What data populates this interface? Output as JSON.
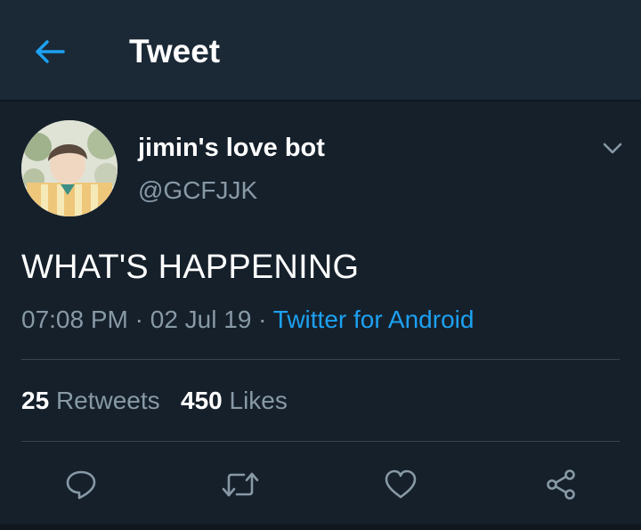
{
  "header": {
    "title": "Tweet",
    "back_icon": "arrow-left-icon"
  },
  "tweet": {
    "display_name": "jimin's love bot",
    "handle": "@GCFJJK",
    "text": "WHAT'S HAPPENING",
    "time": "07:08 PM",
    "separator_1": " · ",
    "date": "02 Jul 19",
    "separator_2": " · ",
    "source": "Twitter for Android",
    "more_icon": "chevron-down-icon"
  },
  "stats": {
    "retweets_count": "25",
    "retweets_label": "Retweets",
    "likes_count": "450",
    "likes_label": "Likes"
  },
  "actions": [
    {
      "icon": "reply-icon"
    },
    {
      "icon": "retweet-icon"
    },
    {
      "icon": "like-heart-icon"
    },
    {
      "icon": "share-icon"
    }
  ],
  "colors": {
    "background": "#15202b",
    "header_background": "#1b2836",
    "accent": "#1da1f2",
    "secondary_text": "#8899a6",
    "divider": "#38444d"
  }
}
